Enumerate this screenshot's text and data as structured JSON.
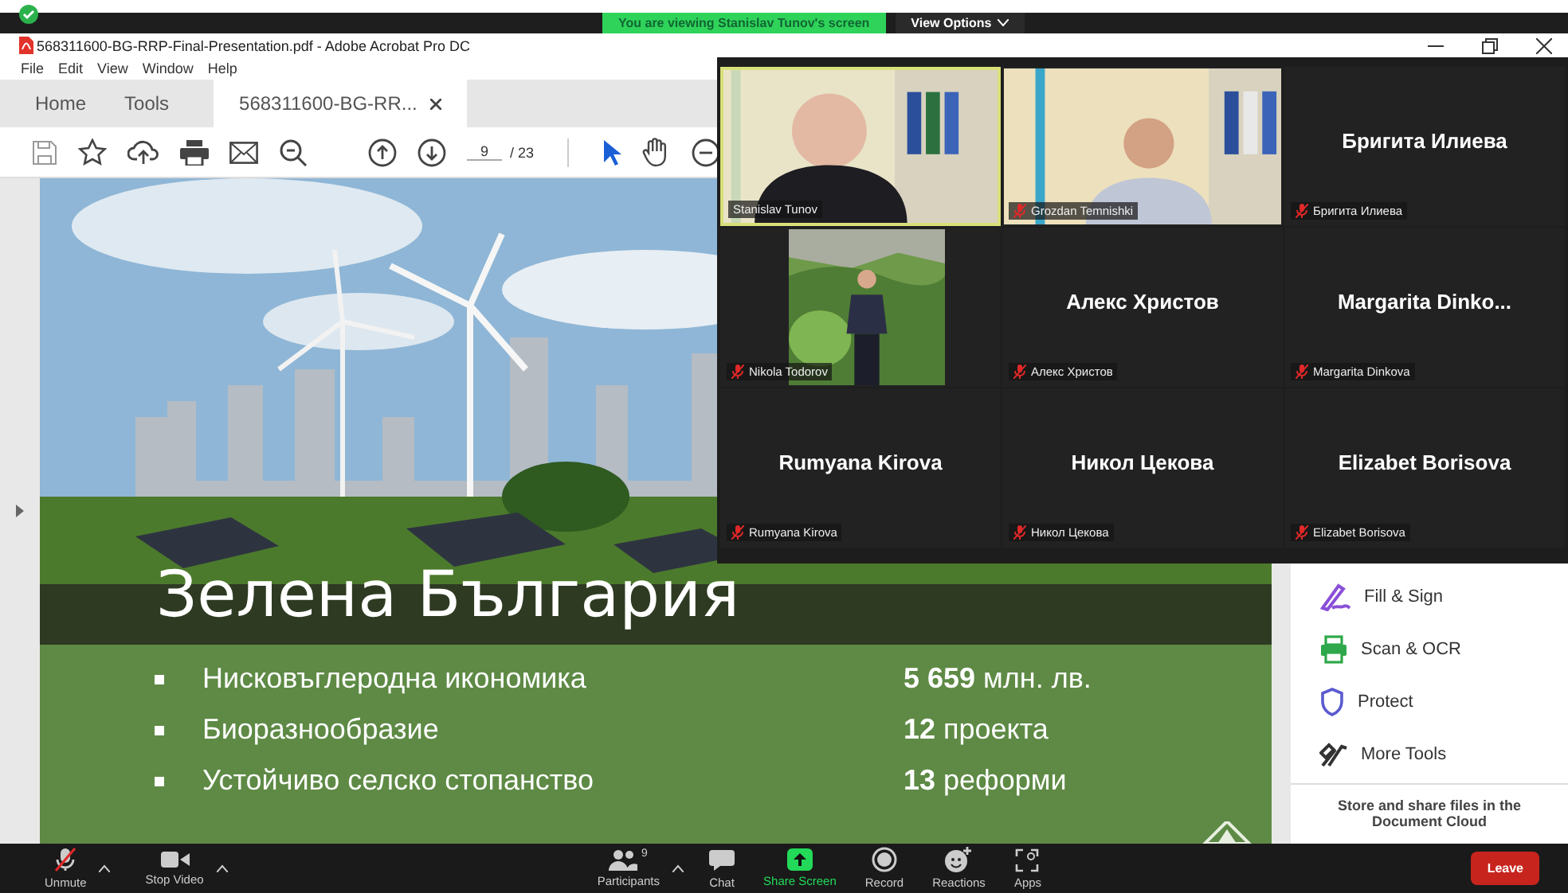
{
  "share_banner": {
    "text": "You are viewing Stanislav Tunov's screen",
    "view_options": "View Options"
  },
  "acrobat": {
    "title": "568311600-BG-RRP-Final-Presentation.pdf - Adobe Acrobat Pro DC",
    "menu": [
      "File",
      "Edit",
      "View",
      "Window",
      "Help"
    ],
    "tabs": [
      {
        "label": "Home",
        "selected": false,
        "closable": false
      },
      {
        "label": "Tools",
        "selected": false,
        "closable": false
      },
      {
        "label": "568311600-BG-RR...",
        "selected": true,
        "closable": true
      }
    ],
    "page_current": "9",
    "page_total": "/ 23",
    "slide": {
      "title": "Зелена България",
      "bullets": [
        {
          "text": "Нисковъглеродна икономика",
          "amount": "**5 659** млн. лв."
        },
        {
          "text": "Биоразнообразие",
          "amount": "**12** проекта"
        },
        {
          "text": "Устойчиво селско стопанство",
          "amount": "**13** реформи"
        }
      ]
    },
    "tools_panel": {
      "items": [
        {
          "label": "Fill & Sign",
          "kind": "fill-sign"
        },
        {
          "label": "Scan & OCR",
          "kind": "scan"
        },
        {
          "label": "Protect",
          "kind": "protect"
        },
        {
          "label": "More Tools",
          "kind": "more-tools"
        }
      ],
      "promo": "Store and share files in the Document Cloud"
    }
  },
  "gallery": [
    {
      "kind": "video",
      "label": "Stanislav Tunov",
      "active": true,
      "muted": false
    },
    {
      "kind": "video",
      "label": "Grozdan Temnishki",
      "active": false,
      "muted": true
    },
    {
      "kind": "name",
      "display_name": "Бригита Илиева",
      "label": "Бригита Илиева",
      "active": false,
      "muted": true
    },
    {
      "label": "Nikola Todorov",
      "active": false,
      "muted": true
    },
    {
      "kind": "name",
      "display_name": "Алекс Христов",
      "label": "Алекс Христов",
      "active": false,
      "muted": true
    },
    {
      "kind": "name",
      "display_name": "Margarita  Dinko...",
      "label": "Margarita Dinkova",
      "active": false,
      "muted": true
    },
    {
      "kind": "name",
      "display_name": "Rumyana Kirova",
      "label": "Rumyana Kirova",
      "active": false,
      "muted": true
    },
    {
      "kind": "name",
      "display_name": "Никол Цекова",
      "label": "Никол Цекова",
      "active": false,
      "muted": true
    },
    {
      "kind": "name",
      "display_name": "Elizabet Borisova",
      "label": "Elizabet Borisova",
      "active": false,
      "muted": true
    }
  ],
  "meeting_controls": {
    "left": [
      {
        "kind": "unmute",
        "label": "Unmute",
        "caret": true,
        "highlighted": false
      },
      {
        "kind": "video",
        "label": "Stop Video",
        "caret": true,
        "highlighted": false
      }
    ],
    "center": [
      {
        "kind": "participants",
        "label": "Participants",
        "count": "9",
        "caret": true,
        "highlighted": false
      },
      {
        "kind": "chat",
        "label": "Chat",
        "caret": false,
        "highlighted": false
      },
      {
        "kind": "share",
        "label": "Share Screen",
        "caret": false,
        "highlighted": true
      },
      {
        "kind": "record",
        "label": "Record",
        "caret": false,
        "highlighted": false
      },
      {
        "kind": "reactions",
        "label": "Reactions",
        "caret": false,
        "highlighted": false
      },
      {
        "kind": "apps",
        "label": "Apps",
        "caret": false,
        "highlighted": false
      }
    ],
    "leave": "Leave"
  }
}
